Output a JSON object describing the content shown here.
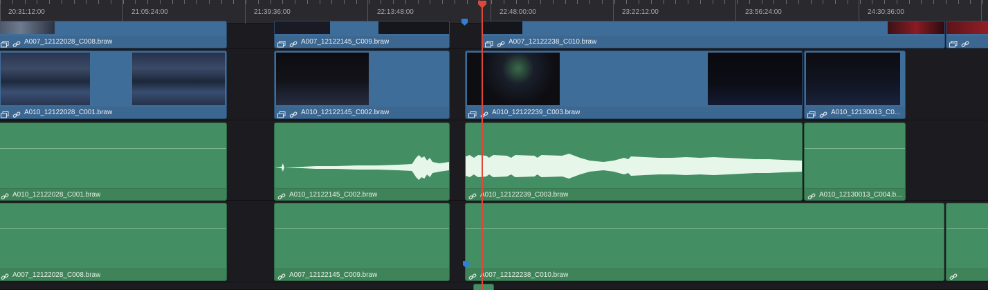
{
  "ruler": {
    "timecodes": [
      "20:31:12:00",
      "21:05:24:00",
      "21:39:36:00",
      "22:13:48:00",
      "22:48:00:00",
      "23:22:12:00",
      "23:56:24:00",
      "24:30:36:00"
    ]
  },
  "tracks": {
    "v2": {
      "clips": [
        {
          "name": "A007_12122028_C008.braw"
        },
        {
          "name": "A007_12122145_C009.braw"
        },
        {
          "name": "A007_12122238_C010.braw"
        },
        {
          "name": ""
        }
      ]
    },
    "v1": {
      "clips": [
        {
          "name": "A010_12122028_C001.braw"
        },
        {
          "name": "A010_12122145_C002.braw"
        },
        {
          "name": "A010_12122239_C003.braw"
        },
        {
          "name": "A010_12130013_C0..."
        }
      ]
    },
    "a1": {
      "clips": [
        {
          "name": "A010_12122028_C001.braw"
        },
        {
          "name": "A010_12122145_C002.braw"
        },
        {
          "name": "A010_12122239_C003.braw"
        },
        {
          "name": "A010_12130013_C004.b..."
        }
      ]
    },
    "a2": {
      "clips": [
        {
          "name": "A007_12122028_C008.braw"
        },
        {
          "name": "A007_12122145_C009.braw"
        },
        {
          "name": "A007_12122238_C010.braw"
        },
        {
          "name": ""
        }
      ]
    }
  },
  "colors": {
    "video_clip": "#3f6d99",
    "audio_clip": "#448e63",
    "playhead": "#e0463a",
    "marker": "#2f7fd6",
    "waveform": "#e6f7ea"
  },
  "icons": {
    "clip_type": "linked-clips-icon",
    "link": "link-icon"
  }
}
